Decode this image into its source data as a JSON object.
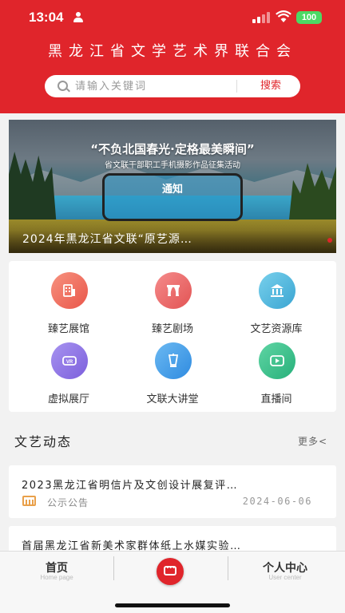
{
  "status_bar": {
    "time": "13:04",
    "battery": "100"
  },
  "header": {
    "title": "黑龙江省文学艺术界联合会",
    "search_placeholder": "请输入关键词",
    "search_button": "搜索"
  },
  "banner": {
    "headline": "“不负北国春光·定格最美瞬间”",
    "subline": "省文联干部职工手机摄影作品征集活动",
    "notice": "通知",
    "caption": "2024年黑龙江省文联“原艺源…"
  },
  "grid": {
    "items": [
      {
        "label": "臻艺展馆",
        "icon": "gallery-icon",
        "color": "#ef6a5a"
      },
      {
        "label": "臻艺剧场",
        "icon": "theater-icon",
        "color": "#ef6a6a"
      },
      {
        "label": "文艺资源库",
        "icon": "library-icon",
        "color": "#4ab5d8"
      },
      {
        "label": "虚拟展厅",
        "icon": "vr-icon",
        "color": "#8a72e0"
      },
      {
        "label": "文联大讲堂",
        "icon": "lecture-icon",
        "color": "#3f9fe8"
      },
      {
        "label": "直播间",
        "icon": "live-icon",
        "color": "#36c08a"
      }
    ]
  },
  "section": {
    "title": "文艺动态",
    "more": "更多<"
  },
  "news": [
    {
      "title": "2023黑龙江省明信片及文创设计展复评…",
      "category": "公示公告",
      "date": "2024-06-06"
    },
    {
      "title": "首届黑龙江省新美术家群体纸上水媒实验…"
    }
  ],
  "tabbar": {
    "home": {
      "label": "首页",
      "sub": "Home page"
    },
    "user": {
      "label": "个人中心",
      "sub": "User center"
    }
  }
}
